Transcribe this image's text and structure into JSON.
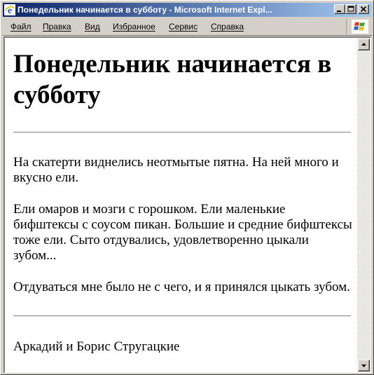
{
  "window": {
    "title": "Понедельник начинается в субботу - Microsoft Internet Expl..."
  },
  "menu": {
    "items": [
      "Файл",
      "Правка",
      "Вид",
      "Избранное",
      "Сервис",
      "Справка"
    ]
  },
  "page": {
    "heading": "Понедельник начинается в субботу",
    "paragraphs": [
      "На скатерти виднелись неотмытые пятна. На ней много и вкусно ели.",
      "Ели омаров и мозги с горошком. Ели маленькие бифштексы с соусом пикан. Большие и средние бифштексы тоже ели. Сыто отдувались, удовлетворенно цыкали зубом...",
      "Отдуваться мне было не с чего, и я принялся цыкать зубом."
    ],
    "author": "Аркадий и Борис Стругацкие"
  },
  "icons": {
    "app": "internet-explorer-icon",
    "minimize": "minimize-icon",
    "maximize": "maximize-icon",
    "close": "close-icon",
    "throbber": "windows-logo-icon",
    "scroll_up": "arrow-up-icon",
    "scroll_down": "arrow-down-icon"
  },
  "colors": {
    "title_gradient_start": "#0a246a",
    "title_gradient_end": "#a6caf0",
    "chrome": "#d4d0c8",
    "page_background": "#ffffff"
  }
}
